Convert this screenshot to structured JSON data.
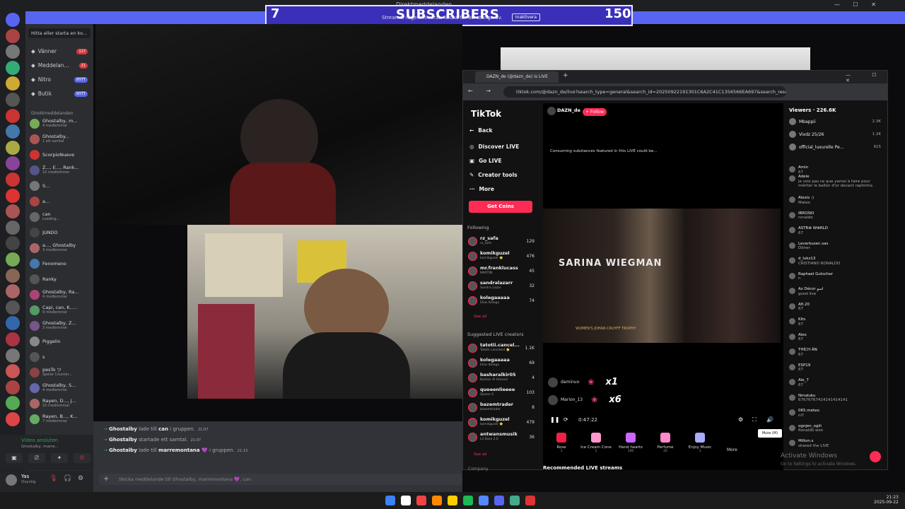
{
  "discord": {
    "title": "Direktmeddelanden",
    "search": "Hitta eller starta en ko...",
    "nav": [
      {
        "label": "Vänner",
        "badge": "117"
      },
      {
        "label": "Meddelan...",
        "badge": "21"
      },
      {
        "label": "Nitro",
        "badge": "NYTT"
      },
      {
        "label": "Butik",
        "badge": "NYTT"
      }
    ],
    "dm_header": "Direktmeddelanden",
    "dms": [
      {
        "name": "Ghostalby, m...",
        "sub": "4 medlemmar",
        "color": "#7a5"
      },
      {
        "name": "Ghostalby...",
        "sub": "1 ett samtal",
        "color": "#a55"
      },
      {
        "name": "ScorpioNueve",
        "sub": "",
        "color": "#c33"
      },
      {
        "name": "Z..., E..., Rank...",
        "sub": "10 medlemmar",
        "color": "#558"
      },
      {
        "name": "S...",
        "sub": "",
        "color": "#777"
      },
      {
        "name": "a...",
        "sub": "",
        "color": "#a44"
      },
      {
        "name": "can",
        "sub": "Loading...",
        "color": "#666"
      },
      {
        "name": "JUNDO",
        "sub": "",
        "color": "#444"
      },
      {
        "name": "a..., Ghostalby",
        "sub": "3 medlemmar",
        "color": "#a66"
      },
      {
        "name": "Fenomeno",
        "sub": "",
        "color": "#47a"
      },
      {
        "name": "Ranky",
        "sub": "",
        "color": "#555"
      },
      {
        "name": "Ghostalby, Ra...",
        "sub": "4 medlemmar",
        "color": "#a47"
      },
      {
        "name": "Capi, can, K.....",
        "sub": "9 medlemmar",
        "color": "#596"
      },
      {
        "name": "Ghostalby, Z...",
        "sub": "3 medlemmar",
        "color": "#758"
      },
      {
        "name": "Piggelin",
        "sub": "",
        "color": "#888"
      },
      {
        "name": "s",
        "sub": "",
        "color": "#555"
      },
      {
        "name": "pesTo ツ",
        "sub": "Spelar Counter...",
        "color": "#844"
      },
      {
        "name": "Ghostalby, S...",
        "sub": "4 medlemmar",
        "color": "#66a"
      },
      {
        "name": "Rayen, D..., J...",
        "sub": "10 medlemmar",
        "color": "#a66"
      },
      {
        "name": "Rayen, B..., K...",
        "sub": "7 medlemmar",
        "color": "#6a6"
      }
    ],
    "voice": {
      "title": "Video ansluten",
      "sub": "Ghostalby, marre..."
    },
    "user": {
      "name": "Yas",
      "status": "Osynlig"
    },
    "system_msgs": [
      {
        "who": "Ghostalby",
        "text": " lade till ",
        "target": "can",
        "tail": " i gruppen.",
        "time": "21:07"
      },
      {
        "who": "Ghostalby",
        "text": " startade ett samtal.",
        "target": "",
        "tail": "",
        "time": "21:07"
      },
      {
        "who": "Ghostalby",
        "text": " lade till ",
        "target": "marremontana 💜",
        "tail": " i gruppen.",
        "time": "21:13"
      }
    ],
    "message_placeholder": "Skicka meddelande till Ghostalby, marremontana 💜, can"
  },
  "overlay": {
    "left": "7",
    "title": "SUBSCRIBERS",
    "right": "150",
    "sub": "Streamer-läge aktiverat. Klicka för att stänga av.",
    "button": "Inaktivera"
  },
  "browser": {
    "tab": "DAZN_de (@dazn_de) is LIVE",
    "url": "tiktok.com/@dazn_de/live?search_type=general&search_id=20250922191301C6A2C41C1356566EA697&search_result_..."
  },
  "tiktok": {
    "logo": "TikTok",
    "back": "Back",
    "nav": [
      "Discover LIVE",
      "Go LIVE",
      "Creator tools",
      "More"
    ],
    "coins": "Get Coins",
    "following_title": "Following",
    "following": [
      {
        "name": "rz_safa",
        "sub": "rz_safa",
        "count": "129"
      },
      {
        "name": "komikguzel",
        "sub": "komikguzel ⭐",
        "count": "476"
      },
      {
        "name": "mr.franklucass",
        "sub": "MARTIN",
        "count": "45"
      },
      {
        "name": "sandralazarr",
        "sub": "Sandra Lazar",
        "count": "32"
      },
      {
        "name": "kolegaaaaa",
        "sub": "Elias Kolega",
        "count": "74"
      }
    ],
    "see_all": "See all",
    "suggested_title": "Suggested LIVE creators",
    "suggested": [
      {
        "name": "tatotii.cancel...",
        "sub": "Tatotii.canceled ⭐",
        "count": "1.1K"
      },
      {
        "name": "kolegaaaaa",
        "sub": "Elias Kolega",
        "count": "69"
      },
      {
        "name": "basharalkir05",
        "sub": "Bashar Al Hamed",
        "count": "4"
      },
      {
        "name": "queeenlieeee",
        "sub": "Queen S",
        "count": "103"
      },
      {
        "name": "bazemtrader",
        "sub": "bazemtrader",
        "count": "8"
      },
      {
        "name": "komikguzel",
        "sub": "komikguzel ⭐",
        "count": "479"
      },
      {
        "name": "antwansmusik",
        "sub": "Lil Sosa 2.0",
        "count": "36"
      }
    ],
    "company": "Company",
    "host": "DAZN_de",
    "follow": "+ Follow",
    "warning": "Consuming substances featured in this LIVE could be...",
    "stream_name": "SARINA WIEGMAN",
    "stream_label": "WOMEN'S JOHAN CRUYFF TROPHY",
    "gifts": [
      {
        "user": "daminuo",
        "mult": "x1"
      },
      {
        "user": "Marion_13",
        "mult": "x6"
      }
    ],
    "time": "0:47:22",
    "gift_items": [
      {
        "name": "Rose",
        "price": "1",
        "color": "#e24"
      },
      {
        "name": "Ice Cream Cone",
        "price": "1",
        "color": "#f9c"
      },
      {
        "name": "Hand hearts",
        "price": "100",
        "color": "#c6f"
      },
      {
        "name": "Perfume",
        "price": "20",
        "color": "#f8c"
      },
      {
        "name": "Enjoy Music",
        "price": "1",
        "color": "#aaf"
      }
    ],
    "more": "More",
    "mute": "Mute (M)",
    "recommended": "Recommended LIVE streams",
    "viewers": "Viewers · 226.6K",
    "top": [
      {
        "name": "Mbappii",
        "v": "2.3K"
      },
      {
        "name": "Vixdz 25/26",
        "v": "1.2K"
      },
      {
        "name": "official_luxurelle Pe...",
        "v": "915"
      }
    ],
    "comments": [
      {
        "u": "Amin",
        "t": "67"
      },
      {
        "u": "Adele",
        "t": "je vois pas ce que yamal à faire pour mériter le ballon d'or devant raphinha"
      },
      {
        "u": "Alexis :)",
        "t": "Mateo"
      },
      {
        "u": "IBROSKI",
        "t": "ronaldo"
      },
      {
        "u": "ASTR⊗ W⊗RLD",
        "t": "67"
      },
      {
        "u": "Leverkusen.sas",
        "t": "Döner"
      },
      {
        "u": "d_lukz13",
        "t": "CRISTIANO RONALDO"
      },
      {
        "u": "Raphael Gutscher",
        "t": "n"
      },
      {
        "u": "Az Décor اسو",
        "t": "good live"
      },
      {
        "u": "Afi.20",
        "t": "67"
      },
      {
        "u": "Kits",
        "t": "67"
      },
      {
        "u": "Alex",
        "t": "67"
      },
      {
        "u": "THÍCH ĂN",
        "t": "67"
      },
      {
        "u": "ESP19",
        "t": "67"
      },
      {
        "u": "Ale_7",
        "t": "67"
      },
      {
        "u": "Nmaluku",
        "t": "67676767414141414141"
      },
      {
        "u": "065.meteo",
        "t": "nl?"
      },
      {
        "u": "ognjen_ogiii",
        "t": "Ronaldo won"
      },
      {
        "u": "Milton.s",
        "t": "shared the LIVE"
      }
    ],
    "activate": "Activate Windows",
    "activate_sub": "Go to Settings to activate Windows."
  },
  "clock": {
    "time": "21:23",
    "date": "2025-09-22"
  }
}
